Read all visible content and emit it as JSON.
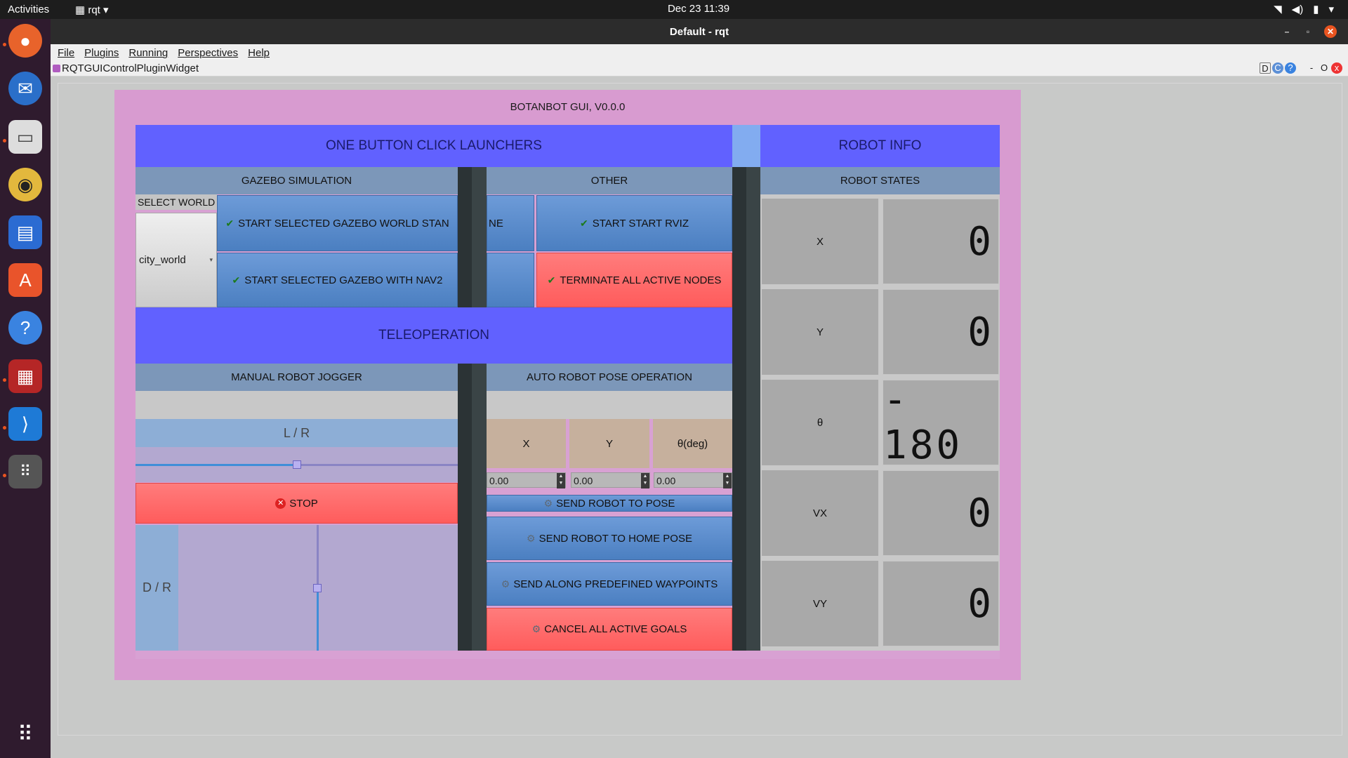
{
  "topbar": {
    "activities": "Activities",
    "app_menu": "rqt",
    "clock": "Dec 23  11:39"
  },
  "window": {
    "title": "Default - rqt",
    "menus": [
      "File",
      "Plugins",
      "Running",
      "Perspectives",
      "Help"
    ],
    "plugin_title": "RQTGUIControlPluginWidget",
    "plugin_controls": [
      "D",
      "C",
      "?",
      "-",
      "O",
      "x"
    ]
  },
  "gui": {
    "title": "BOTANBOT GUI, V0.0.0",
    "launchers_header": "ONE BUTTON CLICK LAUNCHERS",
    "robot_info_header": "ROBOT INFO",
    "gazebo_header": "GAZEBO SIMULATION",
    "other_header": "OTHER",
    "robot_states_header": "ROBOT STATES",
    "select_world_label": "SELECT WORLD",
    "world_value": "city_world",
    "btn_start_gazebo_standalone": "START SELECTED GAZEBO WORLD STAN",
    "btn_start_gazebo_standalone_tail": "NE",
    "btn_start_gazebo_nav2": "START SELECTED GAZEBO WITH NAV2",
    "btn_start_rviz": "START START RVIZ",
    "btn_terminate": "TERMINATE ALL ACTIVE NODES",
    "teleop_header": "TELEOPERATION",
    "jogger_header": "MANUAL ROBOT JOGGER",
    "auto_pose_header": "AUTO ROBOT POSE OPERATION",
    "lr_label": "L / R",
    "dr_label": "D / R",
    "stop_label": "STOP",
    "pose_cols": [
      "X",
      "Y",
      "θ(deg)"
    ],
    "pose_values": [
      "0.00",
      "0.00",
      "0.00"
    ],
    "btn_send_pose": "SEND ROBOT TO  POSE",
    "btn_home": "SEND ROBOT TO HOME POSE",
    "btn_waypoints": "SEND ALONG PREDEFINED WAYPOINTS",
    "btn_cancel": "CANCEL ALL ACTIVE GOALS",
    "states": [
      {
        "label": "X",
        "value": "0"
      },
      {
        "label": "Y",
        "value": "0"
      },
      {
        "label": "θ",
        "value": "- 180"
      },
      {
        "label": "VX",
        "value": "0"
      },
      {
        "label": "VY",
        "value": "0"
      }
    ],
    "lr_slider_fraction": 0.5,
    "dr_slider_fraction": 0.5
  },
  "colors": {
    "frame": "#d89bd0",
    "header_blue": "#6161ff",
    "sub_header": "#7c97b9",
    "button_blue": "#5a8bcc",
    "button_red": "#ff6464"
  }
}
